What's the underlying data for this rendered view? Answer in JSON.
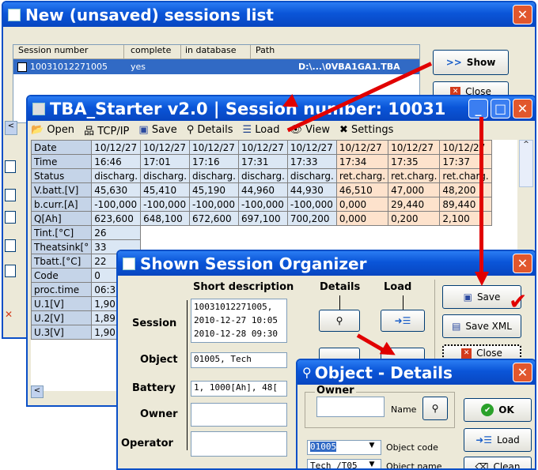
{
  "sessions_window": {
    "title": "New (unsaved) sessions list",
    "columns": [
      "Session number",
      "complete",
      "in database",
      "Path"
    ],
    "row": {
      "session": "10031012271005",
      "complete": "yes",
      "in_database": "",
      "path": "D:\\...\\0VBA1GA1.TBA"
    },
    "show_label": "Show",
    "close_label": "Close"
  },
  "starter_window": {
    "title": "TBA_Starter v2.0 | Session number: 10031",
    "toolbar": [
      "Open",
      "TCP/IP",
      "Save",
      "Details",
      "Load",
      "View",
      "Settings"
    ],
    "rows": [
      {
        "label": "Date",
        "values": [
          "10/12/27",
          "10/12/27",
          "10/12/27",
          "10/12/27",
          "10/12/27",
          "10/12/27",
          "10/12/27",
          "10/12/27"
        ]
      },
      {
        "label": "Time",
        "values": [
          "16:46",
          "17:01",
          "17:16",
          "17:31",
          "17:33",
          "17:34",
          "17:35",
          "17:37"
        ]
      },
      {
        "label": "Status",
        "values": [
          "discharg.",
          "discharg.",
          "discharg.",
          "discharg.",
          "discharg.",
          "ret.charg.",
          "ret.charg.",
          "ret.charg."
        ]
      },
      {
        "label": "V.batt.[V]",
        "values": [
          "45,630",
          "45,410",
          "45,190",
          "44,960",
          "44,930",
          "46,510",
          "47,000",
          "48,200"
        ]
      },
      {
        "label": "b.curr.[A]",
        "values": [
          "-100,000",
          "-100,000",
          "-100,000",
          "-100,000",
          "-100,000",
          "0,000",
          "29,440",
          "89,440"
        ]
      },
      {
        "label": "Q[Ah]",
        "values": [
          "623,600",
          "648,100",
          "672,600",
          "697,100",
          "700,200",
          "0,000",
          "0,200",
          "2,100"
        ]
      },
      {
        "label": "Tint.[°C]",
        "values": [
          "26"
        ]
      },
      {
        "label": "Theatsink[°",
        "values": [
          "33"
        ]
      },
      {
        "label": "Tbatt.[°C]",
        "values": [
          "22"
        ]
      },
      {
        "label": "Code",
        "values": [
          "0"
        ]
      },
      {
        "label": "proc.time",
        "values": [
          "06:3"
        ]
      },
      {
        "label": "U.1[V]",
        "values": [
          "1,90"
        ]
      },
      {
        "label": "U.2[V]",
        "values": [
          "1,89"
        ]
      },
      {
        "label": "U.3[V]",
        "values": [
          "1,90"
        ]
      }
    ]
  },
  "organizer_window": {
    "title": "Shown Session Organizer",
    "headers": {
      "short_description": "Short description",
      "details": "Details",
      "load": "Load"
    },
    "session_label": "Session",
    "session_lines": [
      "10031012271005,",
      "2010-12-27 10:05",
      "2010-12-28 09:30"
    ],
    "object_label": "Object",
    "object_value": "01005, Tech",
    "battery_label": "Battery",
    "battery_value": "1, 1000[Ah], 48[",
    "owner_label": "Owner",
    "operator_label": "Operator",
    "save_label": "Save",
    "save_xml_label": "Save XML",
    "close_label": "Close"
  },
  "details_window": {
    "title": "Object - Details",
    "owner_group": "Owner",
    "name_label": "Name",
    "object_code_value": "01005",
    "object_code_label": "Object code",
    "object_name_value": "Tech /T05",
    "object_name_label": "Object name",
    "ok_label": "OK",
    "load_label": "Load",
    "clean_label": "Clean"
  },
  "colors": {
    "titlebar": "#0a55d8",
    "annotation_arrow": "#e10000",
    "close_button": "#e1572d"
  }
}
